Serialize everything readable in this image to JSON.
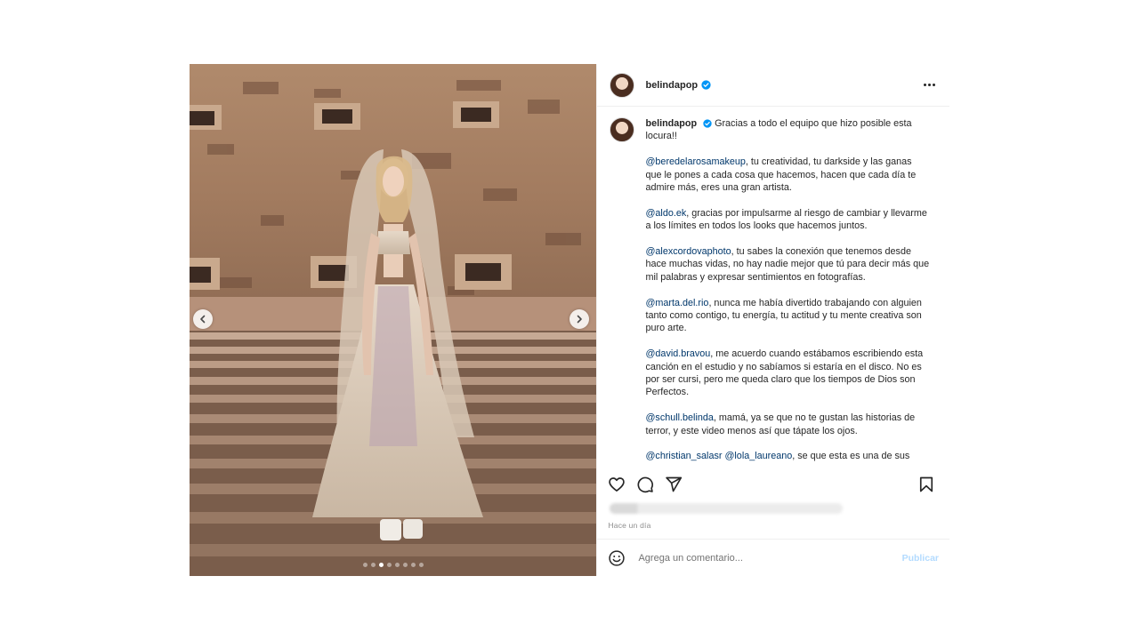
{
  "post": {
    "username": "belindapop",
    "verified": true,
    "colors": {
      "link": "#00376b",
      "verified": "#0095f6",
      "publish_disabled": "#b3dbff"
    }
  },
  "media": {
    "slides_total": 8,
    "active_slide": 3,
    "icons": {
      "prev": "chevron-left-icon",
      "next": "chevron-right-icon"
    }
  },
  "caption": {
    "username": "belindapop",
    "paragraphs": [
      {
        "text": "Gracias a todo el equipo que hizo posible esta locura!!"
      },
      {
        "mention": "@beredelarosamakeup",
        "text": ", tu creatividad, tu darkside y las ganas que le pones a cada cosa que hacemos, hacen que cada día te admire más, eres una gran artista."
      },
      {
        "mention": "@aldo.ek",
        "text": ", gracias por impulsarme al riesgo de cambiar y llevarme a los límites en todos los looks que hacemos juntos."
      },
      {
        "mention": "@alexcordovaphoto",
        "text": ", tu sabes la conexión que tenemos desde hace muchas vidas, no hay nadie mejor que tú para decir más que mil palabras y expresar sentimientos en fotografías."
      },
      {
        "mention": "@marta.del.rio",
        "text": ", nunca me había divertido trabajando con alguien tanto como contigo, tu energía, tu actitud y tu mente creativa son puro arte."
      },
      {
        "mention": "@david.bravou",
        "text": ", me acuerdo cuando estábamos escribiendo esta canción en el estudio y no sabíamos si estaría en el disco. No es por ser cursi, pero me queda claro que los tiempos de Dios son Perfectos."
      },
      {
        "mention": "@schull.belinda",
        "text": ", mamá, ya se que no te gustan las historias de terror, y este video menos así que tápate los ojos."
      },
      {
        "mention": "@christian_salasr",
        "mention2": "@lola_laureano",
        "text": ", se que esta es una de sus"
      }
    ]
  },
  "actions": {
    "icons": [
      "heart-icon",
      "comment-icon",
      "share-icon",
      "bookmark-icon"
    ]
  },
  "timestamp": "Hace un día",
  "comment_box": {
    "placeholder": "Agrega un comentario...",
    "publish_label": "Publicar"
  }
}
